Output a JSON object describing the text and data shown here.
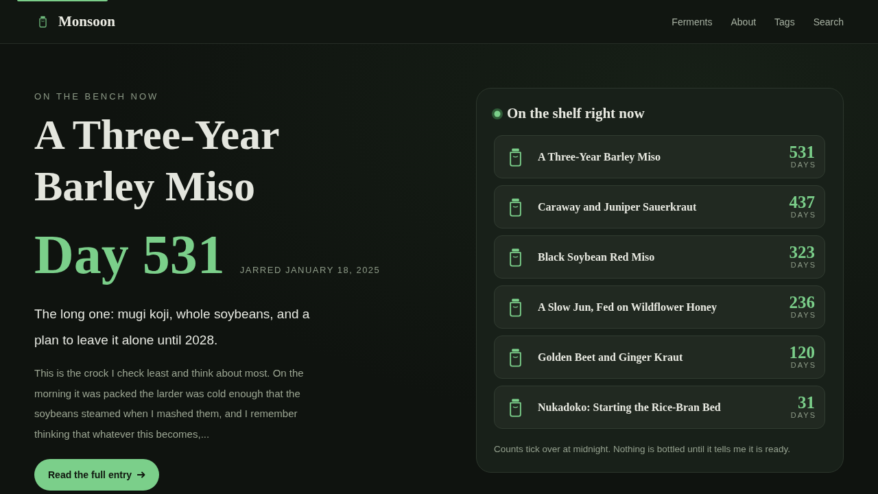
{
  "header": {
    "logo": "Monsoon",
    "nav": [
      "Ferments",
      "About",
      "Tags",
      "Search"
    ]
  },
  "feature": {
    "eyebrow": "ON THE BENCH NOW",
    "title": "A Three-Year Barley Miso",
    "day": "Day 531",
    "date": "JARRED JANUARY 18, 2025",
    "lead": "The long one: mugi koji, whole soybeans, and a plan to leave it alone until 2028.",
    "excerpt": "This is the crock I check least and think about most. On the morning it was packed the larder was cold enough that the soybeans steamed when I mashed them, and I remember thinking that whatever this becomes,...",
    "button": "Read the full entry"
  },
  "shelf": {
    "title": "On the shelf right now",
    "items": [
      {
        "name": "A Three-Year Barley Miso",
        "count": "531",
        "unit": "DAYS"
      },
      {
        "name": "Caraway and Juniper Sauerkraut",
        "count": "437",
        "unit": "DAYS"
      },
      {
        "name": "Black Soybean Red Miso",
        "count": "323",
        "unit": "DAYS"
      },
      {
        "name": "A Slow Jun, Fed on Wildflower Honey",
        "count": "236",
        "unit": "DAYS"
      },
      {
        "name": "Golden Beet and Ginger Kraut",
        "count": "120",
        "unit": "DAYS"
      },
      {
        "name": "Nukadoko: Starting the Rice-Bran Bed",
        "count": "31",
        "unit": "DAYS"
      }
    ],
    "note": "Counts tick over at midnight. Nothing is bottled until it tells me it is ready."
  }
}
